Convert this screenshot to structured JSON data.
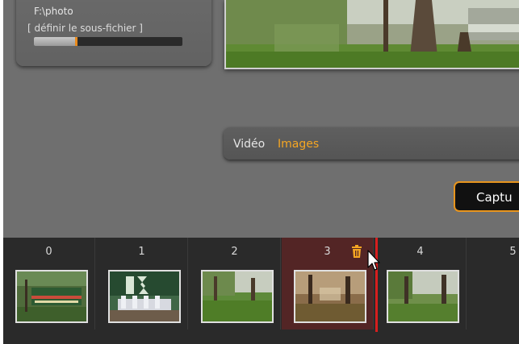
{
  "folder": {
    "path": "F:\\photo",
    "define_subfolder": "[ définir le sous-fichier ]",
    "progress": 0.28
  },
  "modes": {
    "video": "Vidéo",
    "images": "Images",
    "active": "images"
  },
  "capture_button": "Captu",
  "filmstrip": {
    "selected_index": 3,
    "items": [
      {
        "label": "0",
        "icon": "photo-thumbnail"
      },
      {
        "label": "1",
        "icon": "photo-thumbnail"
      },
      {
        "label": "2",
        "icon": "photo-thumbnail"
      },
      {
        "label": "3",
        "icon": "photo-thumbnail"
      },
      {
        "label": "4",
        "icon": "photo-thumbnail"
      },
      {
        "label": "5",
        "icon": "photo-thumbnail"
      }
    ]
  },
  "colors": {
    "accent": "#f5a623",
    "drop_marker": "#d81e1e",
    "selected_cell": "#532525",
    "app_background": "#6f6f6f",
    "filmstrip_background": "#2a2a2a"
  }
}
